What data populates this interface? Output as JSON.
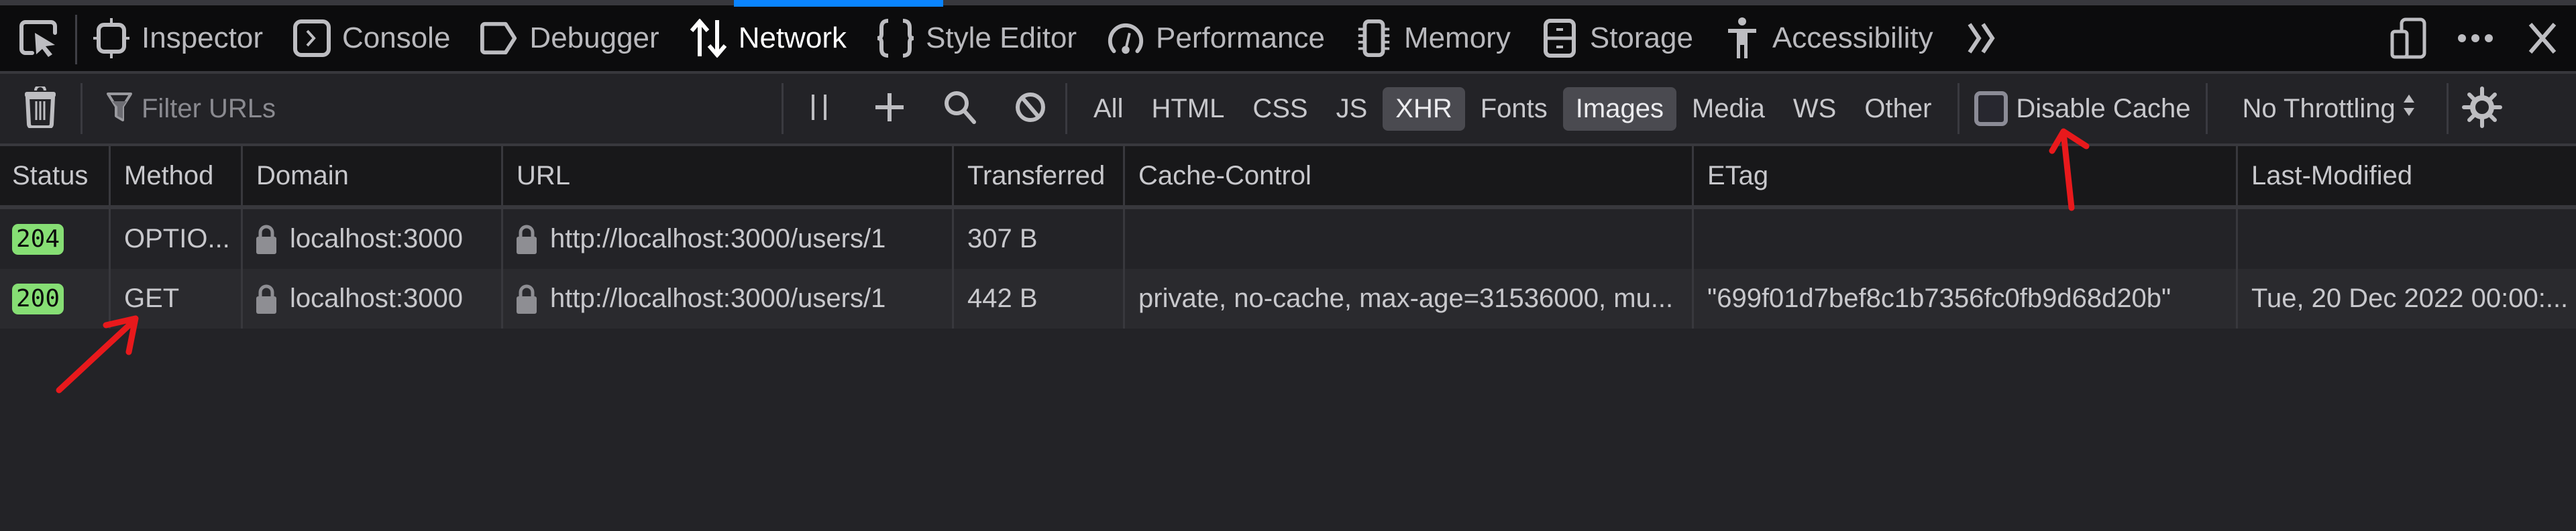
{
  "devtools": {
    "tabs": [
      {
        "label": "Inspector",
        "icon": "inspector-icon"
      },
      {
        "label": "Console",
        "icon": "console-icon"
      },
      {
        "label": "Debugger",
        "icon": "debugger-icon"
      },
      {
        "label": "Network",
        "icon": "network-icon",
        "active": true
      },
      {
        "label": "Style Editor",
        "icon": "style-editor-icon"
      },
      {
        "label": "Performance",
        "icon": "performance-icon"
      },
      {
        "label": "Memory",
        "icon": "memory-icon"
      },
      {
        "label": "Storage",
        "icon": "storage-icon"
      },
      {
        "label": "Accessibility",
        "icon": "accessibility-icon"
      }
    ],
    "accent_color": "#0a84ff"
  },
  "toolbar": {
    "filter_placeholder": "Filter URLs",
    "filter_value": "",
    "type_filters": [
      {
        "label": "All",
        "on": false
      },
      {
        "label": "HTML",
        "on": false
      },
      {
        "label": "CSS",
        "on": false
      },
      {
        "label": "JS",
        "on": false
      },
      {
        "label": "XHR",
        "on": true
      },
      {
        "label": "Fonts",
        "on": false
      },
      {
        "label": "Images",
        "on": true
      },
      {
        "label": "Media",
        "on": false
      },
      {
        "label": "WS",
        "on": false
      },
      {
        "label": "Other",
        "on": false
      }
    ],
    "disable_cache_label": "Disable Cache",
    "disable_cache_checked": false,
    "throttling_value": "No Throttling"
  },
  "table": {
    "columns": [
      "Status",
      "Method",
      "Domain",
      "URL",
      "Transferred",
      "Cache-Control",
      "ETag",
      "Last-Modified"
    ],
    "rows": [
      {
        "status": "204",
        "method": "OPTIO...",
        "domain": "localhost:3000",
        "url": "http://localhost:3000/users/1",
        "transferred": "307 B",
        "cache_control": "",
        "etag": "",
        "last_modified": ""
      },
      {
        "status": "200",
        "method": "GET",
        "domain": "localhost:3000",
        "url": "http://localhost:3000/users/1",
        "transferred": "442 B",
        "cache_control": "private, no-cache, max-age=31536000, mu...",
        "etag": "\"699f01d7bef8c1b7356fc0fb9d68d20b\"",
        "last_modified": "Tue, 20 Dec 2022 00:00:..."
      }
    ],
    "status_color": "#86de74"
  },
  "annotations": {
    "color": "#e8191c"
  }
}
